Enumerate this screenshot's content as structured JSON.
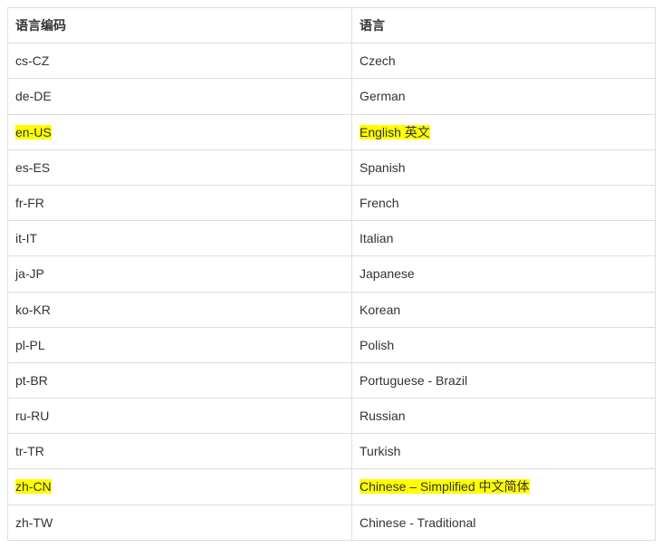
{
  "headers": {
    "code": "语言编码",
    "language": "语言"
  },
  "rows": [
    {
      "code": "cs-CZ",
      "language": "Czech",
      "highlight": false
    },
    {
      "code": "de-DE",
      "language": "German",
      "highlight": false
    },
    {
      "code": "en-US",
      "language": "English 英文",
      "highlight": true
    },
    {
      "code": "es-ES",
      "language": "Spanish",
      "highlight": false
    },
    {
      "code": "fr-FR",
      "language": "French",
      "highlight": false
    },
    {
      "code": "it-IT",
      "language": "Italian",
      "highlight": false
    },
    {
      "code": "ja-JP",
      "language": "Japanese",
      "highlight": false
    },
    {
      "code": "ko-KR",
      "language": "Korean",
      "highlight": false
    },
    {
      "code": "pl-PL",
      "language": "Polish",
      "highlight": false
    },
    {
      "code": "pt-BR",
      "language": "Portuguese - Brazil",
      "highlight": false
    },
    {
      "code": "ru-RU",
      "language": "Russian",
      "highlight": false
    },
    {
      "code": "tr-TR",
      "language": "Turkish",
      "highlight": false
    },
    {
      "code": "zh-CN",
      "language": "Chinese – Simplified 中文简体",
      "highlight": true
    },
    {
      "code": "zh-TW",
      "language": "Chinese - Traditional",
      "highlight": false
    }
  ]
}
